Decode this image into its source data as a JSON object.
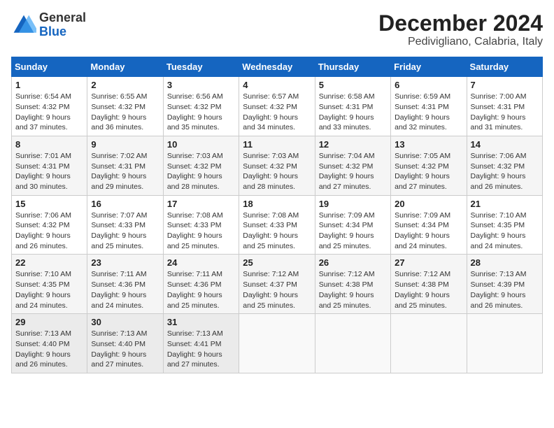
{
  "header": {
    "logo_general": "General",
    "logo_blue": "Blue",
    "month": "December 2024",
    "location": "Pedivigliano, Calabria, Italy"
  },
  "calendar": {
    "days_of_week": [
      "Sunday",
      "Monday",
      "Tuesday",
      "Wednesday",
      "Thursday",
      "Friday",
      "Saturday"
    ],
    "weeks": [
      [
        null,
        null,
        null,
        null,
        null,
        null,
        null
      ]
    ],
    "cells": [
      [
        {
          "day": "1",
          "sunrise": "6:54 AM",
          "sunset": "4:32 PM",
          "daylight": "9 hours and 37 minutes."
        },
        {
          "day": "2",
          "sunrise": "6:55 AM",
          "sunset": "4:32 PM",
          "daylight": "9 hours and 36 minutes."
        },
        {
          "day": "3",
          "sunrise": "6:56 AM",
          "sunset": "4:32 PM",
          "daylight": "9 hours and 35 minutes."
        },
        {
          "day": "4",
          "sunrise": "6:57 AM",
          "sunset": "4:32 PM",
          "daylight": "9 hours and 34 minutes."
        },
        {
          "day": "5",
          "sunrise": "6:58 AM",
          "sunset": "4:31 PM",
          "daylight": "9 hours and 33 minutes."
        },
        {
          "day": "6",
          "sunrise": "6:59 AM",
          "sunset": "4:31 PM",
          "daylight": "9 hours and 32 minutes."
        },
        {
          "day": "7",
          "sunrise": "7:00 AM",
          "sunset": "4:31 PM",
          "daylight": "9 hours and 31 minutes."
        }
      ],
      [
        {
          "day": "8",
          "sunrise": "7:01 AM",
          "sunset": "4:31 PM",
          "daylight": "9 hours and 30 minutes."
        },
        {
          "day": "9",
          "sunrise": "7:02 AM",
          "sunset": "4:31 PM",
          "daylight": "9 hours and 29 minutes."
        },
        {
          "day": "10",
          "sunrise": "7:03 AM",
          "sunset": "4:32 PM",
          "daylight": "9 hours and 28 minutes."
        },
        {
          "day": "11",
          "sunrise": "7:03 AM",
          "sunset": "4:32 PM",
          "daylight": "9 hours and 28 minutes."
        },
        {
          "day": "12",
          "sunrise": "7:04 AM",
          "sunset": "4:32 PM",
          "daylight": "9 hours and 27 minutes."
        },
        {
          "day": "13",
          "sunrise": "7:05 AM",
          "sunset": "4:32 PM",
          "daylight": "9 hours and 27 minutes."
        },
        {
          "day": "14",
          "sunrise": "7:06 AM",
          "sunset": "4:32 PM",
          "daylight": "9 hours and 26 minutes."
        }
      ],
      [
        {
          "day": "15",
          "sunrise": "7:06 AM",
          "sunset": "4:32 PM",
          "daylight": "9 hours and 26 minutes."
        },
        {
          "day": "16",
          "sunrise": "7:07 AM",
          "sunset": "4:33 PM",
          "daylight": "9 hours and 25 minutes."
        },
        {
          "day": "17",
          "sunrise": "7:08 AM",
          "sunset": "4:33 PM",
          "daylight": "9 hours and 25 minutes."
        },
        {
          "day": "18",
          "sunrise": "7:08 AM",
          "sunset": "4:33 PM",
          "daylight": "9 hours and 25 minutes."
        },
        {
          "day": "19",
          "sunrise": "7:09 AM",
          "sunset": "4:34 PM",
          "daylight": "9 hours and 25 minutes."
        },
        {
          "day": "20",
          "sunrise": "7:09 AM",
          "sunset": "4:34 PM",
          "daylight": "9 hours and 24 minutes."
        },
        {
          "day": "21",
          "sunrise": "7:10 AM",
          "sunset": "4:35 PM",
          "daylight": "9 hours and 24 minutes."
        }
      ],
      [
        {
          "day": "22",
          "sunrise": "7:10 AM",
          "sunset": "4:35 PM",
          "daylight": "9 hours and 24 minutes."
        },
        {
          "day": "23",
          "sunrise": "7:11 AM",
          "sunset": "4:36 PM",
          "daylight": "9 hours and 24 minutes."
        },
        {
          "day": "24",
          "sunrise": "7:11 AM",
          "sunset": "4:36 PM",
          "daylight": "9 hours and 25 minutes."
        },
        {
          "day": "25",
          "sunrise": "7:12 AM",
          "sunset": "4:37 PM",
          "daylight": "9 hours and 25 minutes."
        },
        {
          "day": "26",
          "sunrise": "7:12 AM",
          "sunset": "4:38 PM",
          "daylight": "9 hours and 25 minutes."
        },
        {
          "day": "27",
          "sunrise": "7:12 AM",
          "sunset": "4:38 PM",
          "daylight": "9 hours and 25 minutes."
        },
        {
          "day": "28",
          "sunrise": "7:13 AM",
          "sunset": "4:39 PM",
          "daylight": "9 hours and 26 minutes."
        }
      ],
      [
        {
          "day": "29",
          "sunrise": "7:13 AM",
          "sunset": "4:40 PM",
          "daylight": "9 hours and 26 minutes."
        },
        {
          "day": "30",
          "sunrise": "7:13 AM",
          "sunset": "4:40 PM",
          "daylight": "9 hours and 27 minutes."
        },
        {
          "day": "31",
          "sunrise": "7:13 AM",
          "sunset": "4:41 PM",
          "daylight": "9 hours and 27 minutes."
        },
        null,
        null,
        null,
        null
      ]
    ]
  }
}
